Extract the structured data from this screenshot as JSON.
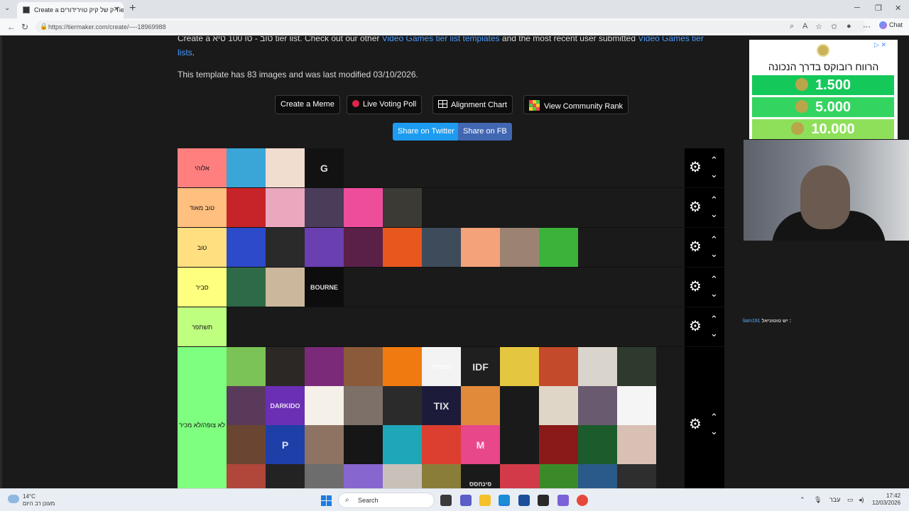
{
  "browser": {
    "tab_title": "Create a ק של קיק טוירידורים Tierliste",
    "new_tab": "+",
    "url": "https://tiermaker.com/create/----18969988",
    "chat_label": "Chat"
  },
  "page": {
    "description_prefix": "Create a טוב - טו 100 טיא tier list. Check out our other ",
    "description_link1": "Video Games tier list templates",
    "description_mid": " and the most recent user submitted ",
    "description_link2": "Video Games tier",
    "description_link2b": "lists",
    "description_suffix": ".",
    "template_info": "This template has 83 images and was last modified 03/10/2026.",
    "buttons": {
      "create_meme": "Create a Meme",
      "live_voting": "Live Voting Poll",
      "alignment_chart": "Alignment Chart",
      "community_rank": "View Community Rank",
      "share_twitter": "Share on Twitter",
      "share_fb": "Share on FB"
    },
    "colors": {
      "twitter": "#1d9bf0",
      "facebook": "#4267b2"
    }
  },
  "tiers": [
    {
      "label": "אלוהי",
      "color": "#ff7f7f",
      "rows": 1,
      "images": [
        {
          "c": "#3aa6d8",
          "t": ""
        },
        {
          "c": "#f1dcd0",
          "t": ""
        },
        {
          "c": "#121212",
          "t": "G"
        }
      ]
    },
    {
      "label": "טוב מאוד",
      "color": "#ffbf7f",
      "rows": 1,
      "images": [
        {
          "c": "#c7242a",
          "t": ""
        },
        {
          "c": "#e9a8be",
          "t": ""
        },
        {
          "c": "#4b3c5a",
          "t": ""
        },
        {
          "c": "#ee4d9c",
          "t": ""
        },
        {
          "c": "#3c3a35",
          "t": ""
        }
      ]
    },
    {
      "label": "טוב",
      "color": "#ffdf7f",
      "rows": 1,
      "images": [
        {
          "c": "#2c4ac9",
          "t": ""
        },
        {
          "c": "#2a2a2a",
          "t": ""
        },
        {
          "c": "#6a3fb0",
          "t": ""
        },
        {
          "c": "#5a2048",
          "t": ""
        },
        {
          "c": "#e8571e",
          "t": ""
        },
        {
          "c": "#3e4b5a",
          "t": ""
        },
        {
          "c": "#f3a27a",
          "t": ""
        },
        {
          "c": "#9b8272",
          "t": ""
        },
        {
          "c": "#3bb33a",
          "t": ""
        }
      ]
    },
    {
      "label": "סביר",
      "color": "#ffff7f",
      "rows": 1,
      "images": [
        {
          "c": "#2f6a48",
          "t": ""
        },
        {
          "c": "#cbb79c",
          "t": ""
        },
        {
          "c": "#0d0d0d",
          "t": "BOURNE"
        }
      ]
    },
    {
      "label": "תשתפר",
      "color": "#bfff7f",
      "rows": 1,
      "images": []
    },
    {
      "label": "לא צופה/לא מכיר",
      "color": "#7fff7f",
      "rows": 4,
      "images": [
        {
          "c": "#7bc257",
          "t": ""
        },
        {
          "c": "#2c2825",
          "t": ""
        },
        {
          "c": "#7a2a78",
          "t": ""
        },
        {
          "c": "#8a5a3a",
          "t": ""
        },
        {
          "c": "#f07a0f",
          "t": ""
        },
        {
          "c": "#f3f3f3",
          "t": "המרדף"
        },
        {
          "c": "#1f1f1f",
          "t": "IDF"
        },
        {
          "c": "#e5c640",
          "t": ""
        },
        {
          "c": "#c34a2a",
          "t": ""
        },
        {
          "c": "#d9d4cc",
          "t": ""
        },
        {
          "c": "#2d3a2d",
          "t": ""
        },
        {
          "c": "#5a3a5a",
          "t": ""
        },
        {
          "c": "#6b2fb5",
          "t": "DARKIDO"
        },
        {
          "c": "#f5f0e8",
          "t": ""
        },
        {
          "c": "#7c7068",
          "t": ""
        },
        {
          "c": "#2b2b2b",
          "t": ""
        },
        {
          "c": "#1c1c3a",
          "t": "TIX"
        },
        {
          "c": "#e08a3a",
          "t": ""
        },
        {
          "c": "#1a1a1a",
          "t": ""
        },
        {
          "c": "#e0d6c8",
          "t": ""
        },
        {
          "c": "#6a5a70",
          "t": ""
        },
        {
          "c": "#f5f5f5",
          "t": ""
        },
        {
          "c": "#6a4632",
          "t": ""
        },
        {
          "c": "#1f3fa8",
          "t": "P"
        },
        {
          "c": "#8e7363",
          "t": ""
        },
        {
          "c": "#161616",
          "t": ""
        },
        {
          "c": "#1fa7b8",
          "t": ""
        },
        {
          "c": "#dc3f2f",
          "t": ""
        },
        {
          "c": "#e8478a",
          "t": "M"
        },
        {
          "c": "#1a1a1a",
          "t": ""
        },
        {
          "c": "#8a1a1a",
          "t": ""
        },
        {
          "c": "#1c5c2c",
          "t": ""
        },
        {
          "c": "#d8c0b4",
          "t": ""
        },
        {
          "c": "#b1463a",
          "t": ""
        },
        {
          "c": "#232323",
          "t": ""
        },
        {
          "c": "#6d6d6d",
          "t": ""
        },
        {
          "c": "#8766cf",
          "t": ""
        },
        {
          "c": "#c9c1b9",
          "t": ""
        },
        {
          "c": "#8a7d3a",
          "t": ""
        },
        {
          "c": "#1a1a1a",
          "t": "פינחסס"
        },
        {
          "c": "#d23a4a",
          "t": ""
        },
        {
          "c": "#3b8a2a",
          "t": ""
        },
        {
          "c": "#2a5a8a",
          "t": ""
        },
        {
          "c": "#2e2e2e",
          "t": ""
        }
      ]
    }
  ],
  "sidebar": {
    "ad_title": "הרווח רובוקס בדרך הנכונה",
    "ad_values": [
      "1.500",
      "5.000",
      "10.000"
    ],
    "ad_colors": [
      "#14c95a",
      "#33d45f",
      "#8ee05a"
    ],
    "chat_user": "liam191",
    "chat_text": "יש טוטוניאל :"
  },
  "taskbar": {
    "temp": "14°C",
    "weather_desc": "מעונן רב היום",
    "search_label": "Search",
    "lang": "עבר",
    "time": "17:42",
    "date": "12/03/2026"
  }
}
